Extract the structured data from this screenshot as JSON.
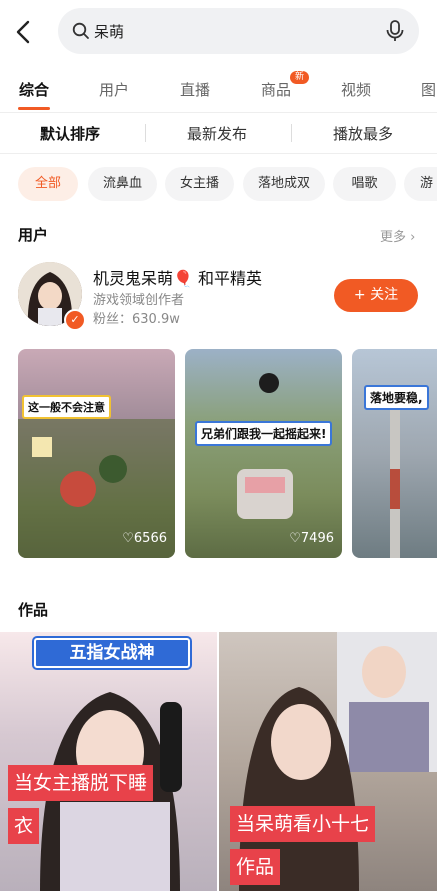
{
  "search": {
    "query": "呆萌"
  },
  "tabs": [
    {
      "label": "综合"
    },
    {
      "label": "用户"
    },
    {
      "label": "直播"
    },
    {
      "label": "商品",
      "badge": "新"
    },
    {
      "label": "视频"
    },
    {
      "label": "图"
    }
  ],
  "sort_options": [
    {
      "label": "默认排序"
    },
    {
      "label": "最新发布"
    },
    {
      "label": "播放最多"
    }
  ],
  "filter_chips": [
    {
      "label": "全部"
    },
    {
      "label": "流鼻血"
    },
    {
      "label": "女主播"
    },
    {
      "label": "落地成双"
    },
    {
      "label": "唱歌"
    },
    {
      "label": "游"
    }
  ],
  "users_section": {
    "title": "用户",
    "more": "更多",
    "user": {
      "name": "机灵鬼呆萌🎈 和平精英",
      "bio": "游戏领域创作者",
      "fans": "粉丝：630.9w",
      "follow_label": "+ 关注"
    },
    "videos": [
      {
        "caption": "这一般不会注意",
        "likes": "6566"
      },
      {
        "caption": "兄弟们跟我一起摇起来!",
        "likes": "7496"
      },
      {
        "caption": "落地要稳,",
        "likes": ""
      }
    ]
  },
  "works_section": {
    "title": "作品",
    "items": [
      {
        "banner": "五指女战神",
        "caption_line1": "当女主播脱下睡",
        "caption_line2": "衣"
      },
      {
        "caption_line1": "当呆萌看小十七",
        "caption_line2": "作品"
      }
    ]
  },
  "colors": {
    "accent": "#f15a24",
    "caption_red": "#e8424a"
  }
}
